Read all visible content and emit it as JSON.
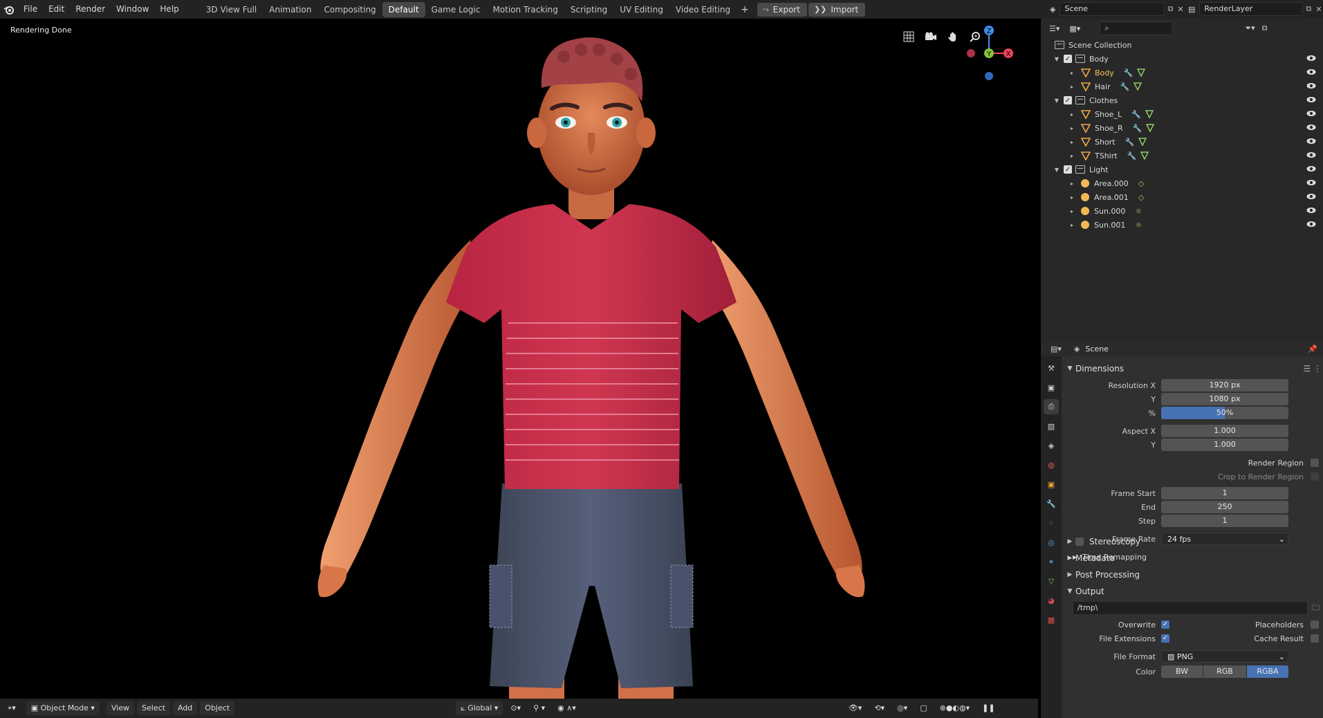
{
  "menu": [
    "File",
    "Edit",
    "Render",
    "Window",
    "Help"
  ],
  "workspaces": [
    "3D View Full",
    "Animation",
    "Compositing",
    "Default",
    "Game Logic",
    "Motion Tracking",
    "Scripting",
    "UV Editing",
    "Video Editing"
  ],
  "active_workspace": "Default",
  "add_workspace": "+",
  "export_label": "Export",
  "import_label": "Import",
  "scene_name": "Scene",
  "view_layer": "RenderLayer",
  "viewport": {
    "status": "Rendering Done",
    "gizmo": {
      "z": "Z",
      "y": "Y",
      "x": "X"
    }
  },
  "bottombar": {
    "mode": "Object Mode",
    "view": "View",
    "select": "Select",
    "add": "Add",
    "object": "Object",
    "orientation": "Global"
  },
  "outliner": {
    "root": "Scene Collection",
    "rows": [
      {
        "label": "Body",
        "type": "collection",
        "level": 1
      },
      {
        "label": "Body",
        "type": "mesh",
        "level": 2,
        "highlight": true
      },
      {
        "label": "Hair",
        "type": "mesh",
        "level": 2
      },
      {
        "label": "Clothes",
        "type": "collection",
        "level": 1
      },
      {
        "label": "Shoe_L",
        "type": "mesh",
        "level": 2
      },
      {
        "label": "Shoe_R",
        "type": "mesh",
        "level": 2
      },
      {
        "label": "Short",
        "type": "mesh",
        "level": 2
      },
      {
        "label": "TShirt",
        "type": "mesh",
        "level": 2
      },
      {
        "label": "Light",
        "type": "collection",
        "level": 1
      },
      {
        "label": "Area.000",
        "type": "light",
        "level": 2
      },
      {
        "label": "Area.001",
        "type": "light",
        "level": 2
      },
      {
        "label": "Sun.000",
        "type": "sun",
        "level": 2
      },
      {
        "label": "Sun.001",
        "type": "sun",
        "level": 2
      }
    ]
  },
  "properties": {
    "context": "Scene",
    "dimensions": {
      "title": "Dimensions",
      "res_x_label": "Resolution X",
      "res_x": "1920 px",
      "res_y_label": "Y",
      "res_y": "1080 px",
      "pct_label": "%",
      "pct": "50%",
      "aspect_x_label": "Aspect X",
      "aspect_x": "1.000",
      "aspect_y_label": "Y",
      "aspect_y": "1.000",
      "render_region": "Render Region",
      "crop_region": "Crop to Render Region",
      "frame_start_label": "Frame Start",
      "frame_start": "1",
      "end_label": "End",
      "end": "250",
      "step_label": "Step",
      "step": "1",
      "fps_label": "Frame Rate",
      "fps": "24 fps",
      "time_remap": "Time Remapping"
    },
    "stereoscopy": "Stereoscopy",
    "metadata": "Metadata",
    "post_processing": "Post Processing",
    "output": {
      "title": "Output",
      "path": "/tmp\\",
      "overwrite": "Overwrite",
      "placeholders": "Placeholders",
      "file_ext": "File Extensions",
      "cache_result": "Cache Result",
      "format_label": "File Format",
      "format": "PNG",
      "color_label": "Color",
      "color_bw": "BW",
      "color_rgb": "RGB",
      "color_rgba": "RGBA"
    }
  },
  "colors": {
    "accent": "#4772b3",
    "header": "#232323",
    "panel": "#303030",
    "shirt": "#c62d4a",
    "skin": "#d9774c",
    "shorts": "#4a5468"
  }
}
